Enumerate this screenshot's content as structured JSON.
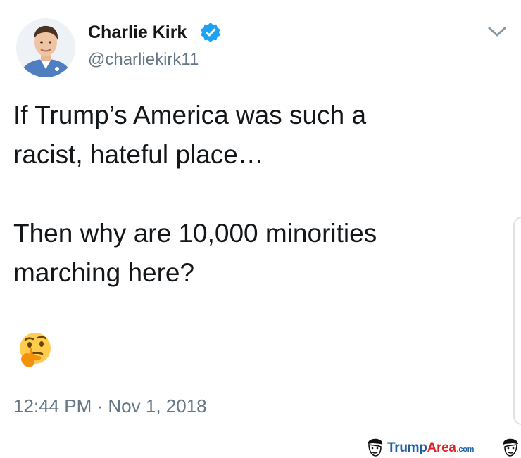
{
  "tweet": {
    "author": {
      "display_name": "Charlie Kirk",
      "handle": "@charliekirk11",
      "verified": true
    },
    "paragraphs": [
      "If Trump’s America was such a\nracist, hateful place…",
      "Then why are 10,000 minorities\nmarching here?"
    ],
    "emoji": "🤔",
    "timestamp": "12:44 PM · Nov 1, 2018"
  },
  "icons": {
    "verified": "verified-badge-icon",
    "menu": "chevron-down-icon",
    "emoji": "thinking-face-icon"
  },
  "watermark": {
    "part1": "Trump",
    "part2": "Area",
    "part3": ".com"
  },
  "colors": {
    "text_primary": "#14171a",
    "text_secondary": "#657786",
    "verified_blue": "#1da1f2",
    "watermark_blue": "#1f5fa6",
    "watermark_red": "#d9252b"
  }
}
